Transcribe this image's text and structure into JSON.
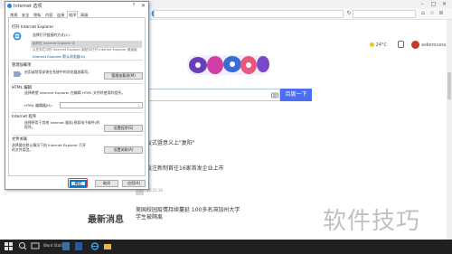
{
  "dialog": {
    "title": "Internet 选项",
    "help": "?",
    "close": "✕",
    "tabs": [
      "常规",
      "安全",
      "隐私",
      "内容",
      "连接",
      "程序",
      "高级"
    ],
    "active_tab_index": 5,
    "open_ie_group": "打开 Internet Explorer",
    "open_ie_desc": "选择打开链接的方式(C)",
    "open_ie_select": "始终在 Internet Explorer 中",
    "checkbox_label": "从任务栏中的 Internet Explorer 磁贴中打开 Internet Explorer 桌面版",
    "default_note": "Internet Explorer 是你的默认浏览器",
    "default_link": "Internet Explorer 默认浏览器(D)",
    "addons_group": "管理加载项",
    "addons_desc": "启用或禁用安装在系统中的浏览器加载项。",
    "addons_button": "管理加载项(M)",
    "html_group": "HTML 编辑",
    "html_desc": "选择希望 Internet Explorer 在编辑 HTML 文件时使用的程序。",
    "html_label": "HTML 编辑器(H):",
    "html_select": "",
    "programs_group": "Internet 程序",
    "programs_desc": "选择将用于其他 Internet 服务(例如电子邮件)的程序。",
    "programs_button": "设置程序(S)",
    "filetypes_group": "文件关联",
    "filetypes_desc": "选择要在默认情况下由 Internet Explorer 打开的文件类型。",
    "filetypes_button": "设置关联(A)",
    "ok": "确定",
    "cancel": "取消",
    "apply": "应用(A)"
  },
  "browser": {
    "weather": "24°C",
    "username": "askerousss",
    "search_button": "百度一下",
    "news_section_title": "最新消息",
    "news": [
      "仪式暨意义上\"复阳\"",
      "板注新制首往16家首发企业上市",
      "美国校园疫情持续蔓延 100多名滞加州大学学生被隔离"
    ],
    "news_meta": "16:22:18"
  },
  "taskbar": {
    "search_hint": "在这里输入你要搜索的内容",
    "label": "Word Statics"
  },
  "watermark": "软件技巧",
  "colors": {
    "accent": "#4e6ef2",
    "highlight": "#e53935",
    "taskbar": "#202020"
  }
}
